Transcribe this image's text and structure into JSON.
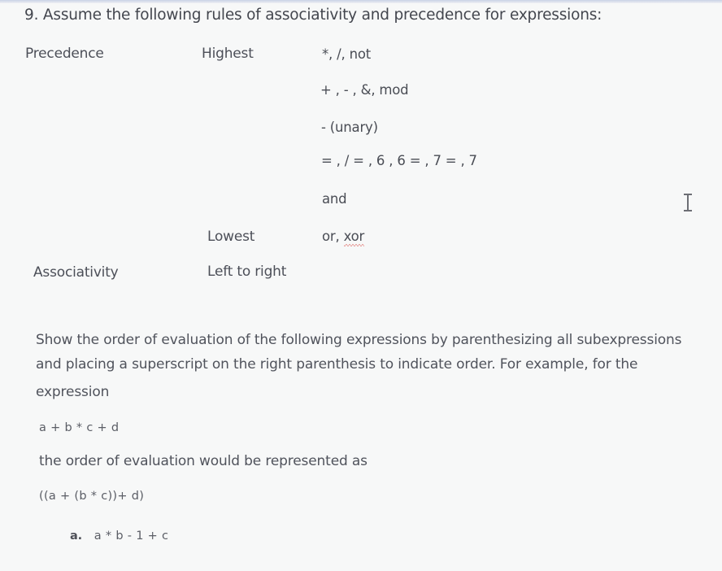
{
  "question": {
    "title": "9. Assume the following rules of associativity and precedence for expressions:"
  },
  "precedence_table": {
    "precedence_label": "Precedence",
    "highest_label": "Highest",
    "lowest_label": "Lowest",
    "levels": [
      "*, /, not",
      "+ , - , &, mod",
      "- (unary)",
      "= , / = , 6 , 6 = , 7 = , 7",
      "and",
      "or, "
    ],
    "last_level_flagged_word": "xor",
    "associativity_label": "Associativity",
    "associativity_value": "Left to right"
  },
  "instructions": {
    "lines": [
      "Show the order of evaluation of the following expressions by parenthesizing all subexpressions",
      "and placing a superscript on the right parenthesis to indicate order. For example, for the",
      "expression"
    ],
    "example_expression": "a + b * c + d",
    "represented_as": "the order of evaluation would be represented as",
    "example_answer": "((a + (b * c))+ d)"
  },
  "exercises": [
    {
      "marker": "a.",
      "expression": "a * b - 1 + c"
    }
  ],
  "cursor": {
    "icon": "text-ibeam-cursor-icon"
  }
}
